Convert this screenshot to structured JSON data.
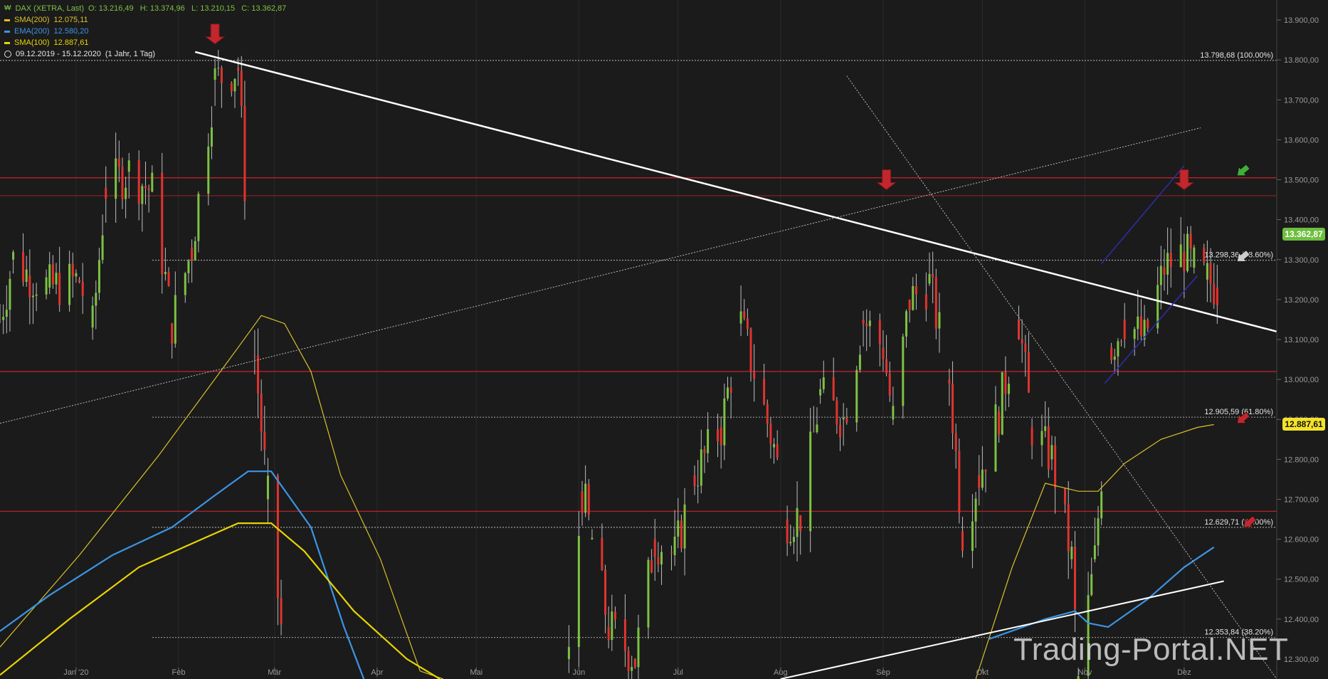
{
  "legend": {
    "main": {
      "name": "DAX (XETRA, Last)",
      "ohlc": "O: 13.216,49   H: 13.374,96   L: 13.210,15   C: 13.362,87",
      "color": "#7dc242"
    },
    "sma200": {
      "name": "SMA(200)",
      "value": "12.075,11",
      "color": "#d7c22a"
    },
    "ema200": {
      "name": "EMA(200)",
      "value": "12.580,20",
      "color": "#3a95e6"
    },
    "sma100": {
      "name": "SMA(100)",
      "value": "12.887,61",
      "color": "#e8d400"
    },
    "range": "09.12.2019 - 15.12.2020",
    "range_detail": "(1 Jahr, 1 Tag)"
  },
  "watermark": "Trading-Portal.NET",
  "price_tags": {
    "last": {
      "text": "13.362,87",
      "value": 13362.87,
      "color": "#6dbf3f"
    },
    "sma100": {
      "text": "12.887,61",
      "value": 12887.61,
      "color": "#f3e22b"
    }
  },
  "chart_data": {
    "type": "candlestick",
    "y_range": [
      12250,
      13950
    ],
    "y_ticks": [
      12300,
      12400,
      12500,
      12600,
      12700,
      12800,
      12900,
      13000,
      13100,
      13200,
      13300,
      13400,
      13500,
      13600,
      13700,
      13800,
      13900
    ],
    "y_tick_labels": [
      "12.300,00",
      "12.400,00",
      "12.500,00",
      "12.600,00",
      "12.700,00",
      "12.800,00",
      "12.900,00",
      "13.000,00",
      "13.100,00",
      "13.200,00",
      "13.300,00",
      "13.400,00",
      "13.500,00",
      "13.600,00",
      "13.700,00",
      "13.800,00",
      "13.900,00"
    ],
    "x_tick_labels": [
      "Jan '20",
      "Feb",
      "Mär",
      "Apr",
      "Mai",
      "Jun",
      "Jul",
      "Aug",
      "Sep",
      "Okt",
      "Nov",
      "Dez"
    ],
    "x_tick_dates": [
      "2020-01-01",
      "2020-02-01",
      "2020-03-01",
      "2020-04-01",
      "2020-05-01",
      "2020-06-01",
      "2020-07-01",
      "2020-08-01",
      "2020-09-01",
      "2020-10-01",
      "2020-11-01",
      "2020-12-01"
    ],
    "x_range": [
      "2019-12-09",
      "2020-12-29"
    ],
    "fib_levels": [
      {
        "value": 13798.68,
        "label": "13.798,68 (100.00%)"
      },
      {
        "value": 13298.36,
        "label": "13.298,36 (78.60%)"
      },
      {
        "value": 12905.59,
        "label": "12.905,59 (61.80%)"
      },
      {
        "value": 12629.71,
        "label": "12.629,71 (50.00%)"
      },
      {
        "value": 12353.84,
        "label": "12.353,84 (38.20%)"
      }
    ],
    "horizontal_lines": [
      13505,
      13460,
      13020,
      12670
    ],
    "trendlines": [
      {
        "from": [
          "2020-02-06",
          13820
        ],
        "to": [
          "2020-12-29",
          13120
        ],
        "color": "#ffffff",
        "width": 2.5
      },
      {
        "from": [
          "2020-08-01",
          12250
        ],
        "to": [
          "2020-12-13",
          12495
        ],
        "color": "#ffffff",
        "width": 2
      },
      {
        "from": [
          "2019-12-09",
          12890
        ],
        "to": [
          "2020-12-06",
          13630
        ],
        "color": "#bbbbbb",
        "dotted": true
      },
      {
        "from": [
          "2020-08-21",
          13760
        ],
        "to": [
          "2020-12-29",
          12250
        ],
        "color": "#bbbbbb",
        "dotted": true
      },
      {
        "from": [
          "2020-11-06",
          13290
        ],
        "to": [
          "2020-12-01",
          13535
        ],
        "color": "#2d2ea8",
        "width": 1.5
      },
      {
        "from": [
          "2020-11-07",
          12990
        ],
        "to": [
          "2020-12-05",
          13260
        ],
        "color": "#2d2ea8",
        "width": 1.5
      }
    ],
    "series": [
      {
        "name": "SMA(200)",
        "color": "#d7c22a",
        "points": [
          [
            "2019-12-09",
            12330
          ],
          [
            "2020-01-02",
            12560
          ],
          [
            "2020-01-26",
            12810
          ],
          [
            "2020-02-19",
            13080
          ],
          [
            "2020-02-26",
            13160
          ],
          [
            "2020-03-04",
            13140
          ],
          [
            "2020-03-12",
            13020
          ],
          [
            "2020-03-21",
            12760
          ],
          [
            "2020-04-02",
            12550
          ],
          [
            "2020-04-14",
            12270
          ],
          [
            "2020-04-21",
            12250
          ]
        ]
      },
      {
        "name": "SMA(100)",
        "color": "#d7c22a",
        "points": [
          [
            "2020-09-29",
            12250
          ],
          [
            "2020-10-10",
            12530
          ],
          [
            "2020-10-20",
            12740
          ],
          [
            "2020-10-30",
            12720
          ],
          [
            "2020-11-05",
            12720
          ],
          [
            "2020-11-13",
            12790
          ],
          [
            "2020-11-24",
            12850
          ],
          [
            "2020-12-05",
            12880
          ],
          [
            "2020-12-10",
            12887
          ]
        ]
      },
      {
        "name": "EMA(200)",
        "color": "#3a95e6",
        "points": [
          [
            "2019-12-09",
            12370
          ],
          [
            "2019-12-24",
            12460
          ],
          [
            "2020-01-12",
            12560
          ],
          [
            "2020-01-30",
            12630
          ],
          [
            "2020-02-12",
            12710
          ],
          [
            "2020-02-22",
            12770
          ],
          [
            "2020-02-29",
            12770
          ],
          [
            "2020-03-12",
            12630
          ],
          [
            "2020-03-22",
            12380
          ],
          [
            "2020-03-28",
            12250
          ]
        ]
      },
      {
        "name": "EMA(200)",
        "color": "#3a95e6",
        "points": [
          [
            "2020-10-03",
            12350
          ],
          [
            "2020-10-20",
            12400
          ],
          [
            "2020-10-29",
            12420
          ],
          [
            "2020-11-02",
            12390
          ],
          [
            "2020-11-08",
            12380
          ],
          [
            "2020-11-20",
            12450
          ],
          [
            "2020-12-01",
            12530
          ],
          [
            "2020-12-10",
            12580
          ]
        ]
      },
      {
        "name": "SMA(200)",
        "color": "#e8d400",
        "points": [
          [
            "2019-12-09",
            12260
          ],
          [
            "2019-12-30",
            12400
          ],
          [
            "2020-01-20",
            12530
          ],
          [
            "2020-02-08",
            12600
          ],
          [
            "2020-02-19",
            12640
          ],
          [
            "2020-02-29",
            12640
          ],
          [
            "2020-03-10",
            12570
          ],
          [
            "2020-03-25",
            12420
          ],
          [
            "2020-04-10",
            12300
          ],
          [
            "2020-04-20",
            12250
          ]
        ]
      }
    ],
    "candles_anchor": [
      [
        "2019-12-09",
        13150
      ],
      [
        "2019-12-13",
        13300
      ],
      [
        "2019-12-18",
        13260
      ],
      [
        "2019-12-24",
        13230
      ],
      [
        "2020-01-02",
        13250
      ],
      [
        "2020-01-06",
        13130
      ],
      [
        "2020-01-10",
        13480
      ],
      [
        "2020-01-17",
        13520
      ],
      [
        "2020-01-24",
        13470
      ],
      [
        "2020-01-30",
        13140
      ],
      [
        "2020-02-05",
        13330
      ],
      [
        "2020-02-12",
        13750
      ],
      [
        "2020-02-19",
        13780
      ],
      [
        "2020-02-24",
        13060
      ],
      [
        "2020-02-28",
        12700
      ],
      [
        "2020-03-04",
        12300
      ],
      [
        "2020-05-29",
        12300
      ],
      [
        "2020-06-02",
        12720
      ],
      [
        "2020-06-05",
        12600
      ],
      [
        "2020-06-10",
        12380
      ],
      [
        "2020-06-18",
        12300
      ],
      [
        "2020-06-24",
        12600
      ],
      [
        "2020-06-30",
        12560
      ],
      [
        "2020-07-06",
        12760
      ],
      [
        "2020-07-14",
        12880
      ],
      [
        "2020-07-20",
        13140
      ],
      [
        "2020-07-24",
        13020
      ],
      [
        "2020-07-30",
        12830
      ],
      [
        "2020-08-03",
        12650
      ],
      [
        "2020-08-07",
        12660
      ],
      [
        "2020-08-13",
        12960
      ],
      [
        "2020-08-20",
        12900
      ],
      [
        "2020-08-26",
        13150
      ],
      [
        "2020-09-01",
        13080
      ],
      [
        "2020-09-04",
        12900
      ],
      [
        "2020-09-09",
        13200
      ],
      [
        "2020-09-15",
        13240
      ],
      [
        "2020-09-21",
        13000
      ],
      [
        "2020-09-25",
        12620
      ],
      [
        "2020-09-30",
        12760
      ],
      [
        "2020-10-06",
        12920
      ],
      [
        "2020-10-12",
        13150
      ],
      [
        "2020-10-16",
        12880
      ],
      [
        "2020-10-22",
        12800
      ],
      [
        "2020-10-28",
        12550
      ],
      [
        "2020-10-30",
        12250
      ],
      [
        "2020-11-04",
        12550
      ],
      [
        "2020-11-09",
        13080
      ],
      [
        "2020-11-13",
        13150
      ],
      [
        "2020-11-19",
        13100
      ],
      [
        "2020-11-25",
        13280
      ],
      [
        "2020-12-01",
        13320
      ],
      [
        "2020-12-04",
        13280
      ],
      [
        "2020-12-08",
        13250
      ],
      [
        "2020-12-11",
        13230
      ],
      [
        "2020-12-14",
        13362
      ]
    ]
  }
}
